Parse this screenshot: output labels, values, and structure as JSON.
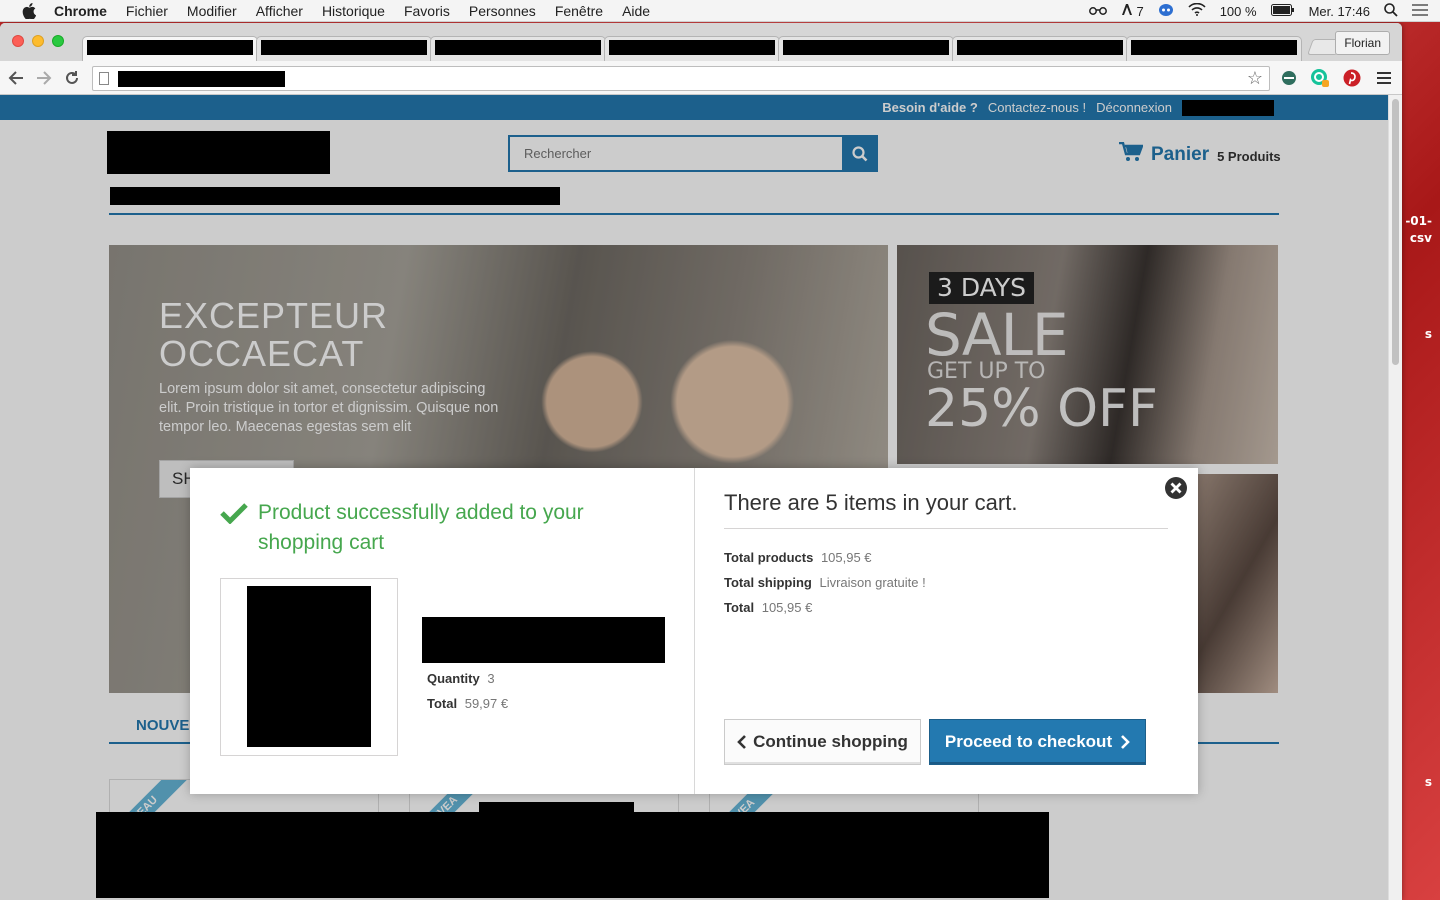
{
  "os_menubar": {
    "app_name": "Chrome",
    "menus": [
      "Fichier",
      "Modifier",
      "Afficher",
      "Historique",
      "Favoris",
      "Personnes",
      "Fenêtre",
      "Aide"
    ],
    "status_badge": "7",
    "battery": "100 %",
    "clock": "Mer. 17:46"
  },
  "browser": {
    "profile_name": "Florian"
  },
  "desktop": {
    "texts": [
      "-01-",
      "csv",
      "s",
      "s"
    ]
  },
  "site": {
    "topnav": {
      "help": "Besoin d'aide ?",
      "contact": "Contactez-nous !",
      "logout": "Déconnexion"
    },
    "search": {
      "placeholder": "Rechercher"
    },
    "cart": {
      "label": "Panier",
      "count": "5 Produits"
    },
    "hero": {
      "heading_line1": "EXCEPTEUR",
      "heading_line2": "OCCAECAT",
      "text": "Lorem ipsum dolor sit amet, consectetur adipiscing elit. Proin tristique in tortor et dignissim. Quisque non tempor leo. Maecenas egestas sem elit",
      "button_partial": "SH"
    },
    "sale_banner": {
      "days": "3 DAYS",
      "sale": "SALE",
      "get_up_to": "GET UP TO",
      "off": "25% OFF"
    },
    "tab_partial": "NOUVE",
    "ribbon_partials": [
      "VEAU",
      "UVEA",
      "VEA"
    ]
  },
  "modal": {
    "success_message": "Product successfully added to your shopping cart",
    "quantity_label": "Quantity",
    "quantity_value": "3",
    "total_label": "Total",
    "total_value": "59,97 €",
    "cart_title": "There are 5 items in your cart.",
    "total_products_label": "Total products",
    "total_products_value": "105,95 €",
    "total_shipping_label": "Total shipping",
    "total_shipping_value": "Livraison gratuite !",
    "grand_total_label": "Total",
    "grand_total_value": "105,95 €",
    "continue_label": "Continue shopping",
    "checkout_label": "Proceed to checkout"
  },
  "colors": {
    "brand_blue": "#2379b0",
    "success_green": "#46a74e"
  }
}
